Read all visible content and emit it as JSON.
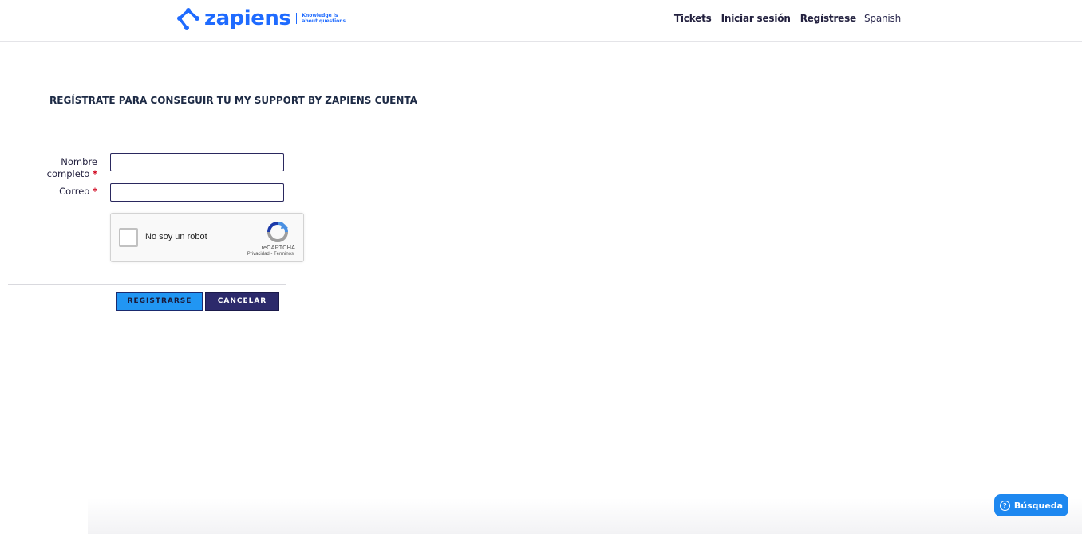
{
  "brand": {
    "name": "zapiens",
    "tagline_line1": "Knowledge is",
    "tagline_line2": "about questions",
    "color": "#1f6bff"
  },
  "nav": {
    "tickets": "Tickets",
    "login": "Iniciar sesión",
    "register": "Regístrese",
    "language": "Spanish"
  },
  "form": {
    "title": "REGÍSTRATE PARA CONSEGUIR TU MY SUPPORT BY ZAPIENS CUENTA",
    "name_label_line1": "Nombre",
    "name_label_line2": "completo",
    "name_value": "",
    "email_label": "Correo",
    "email_value": "",
    "required_marker": "*",
    "captcha": {
      "label": "No soy un robot",
      "brand": "reCAPTCHA",
      "privacy": "Privacidad",
      "separator": "-",
      "terms": "Términos",
      "checked": false
    },
    "submit_label": "REGISTRARSE",
    "cancel_label": "CANCELAR"
  },
  "search_widget": {
    "icon": "question-circle-icon",
    "label": "Búsqueda"
  },
  "colors": {
    "primary_button": "#2196f3",
    "secondary_button": "#2c2a6b",
    "required": "#d0021b",
    "search_widget": "#1e88f0"
  }
}
